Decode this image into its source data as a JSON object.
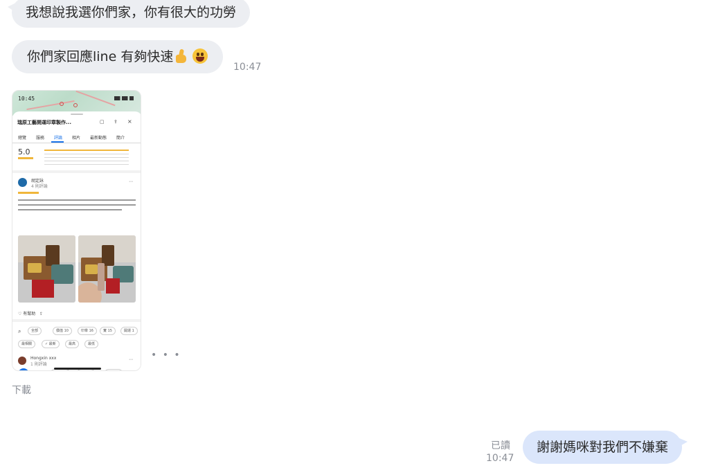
{
  "messages": {
    "m1_text": "我想說我選你們家，你有很大的功勞",
    "m2_text": "你們家回應line 有夠快速",
    "m2_time": "10:47",
    "image_more": "• • •",
    "download_label": "下載",
    "out_text": "謝謝媽咪對我們不嫌棄",
    "out_read": "已讀",
    "out_time": "10:47"
  },
  "screenshot": {
    "status_time": "10:45",
    "place_title": "瑞原工藝開運印章製作...",
    "rating": "5.0"
  },
  "colors": {
    "incoming_bubble": "#eceef2",
    "outgoing_bubble": "#dbe6fb",
    "meta_text": "#8a8e96"
  }
}
